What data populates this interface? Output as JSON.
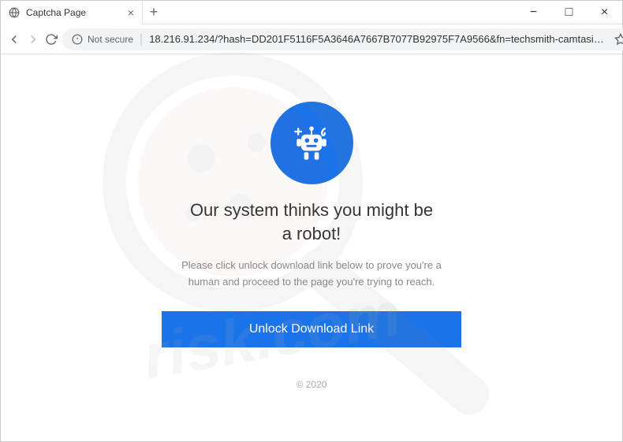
{
  "window": {
    "tab_title": "Captcha Page",
    "minimize": "−",
    "maximize": "□",
    "close": "×"
  },
  "toolbar": {
    "security_label": "Not secure",
    "url": "18.216.91.234/?hash=DD201F5116F5A3646A7667B7077B92975F7A9566&fn=techsmith-camtasia-stu..."
  },
  "page": {
    "heading": "Our system thinks you might be a robot!",
    "subtext": "Please click unlock download link below to prove you're a human and proceed to the page you're trying to reach.",
    "button_label": "Unlock Download Link",
    "copyright": "© 2020"
  },
  "watermark": {
    "text": "risk.com"
  }
}
